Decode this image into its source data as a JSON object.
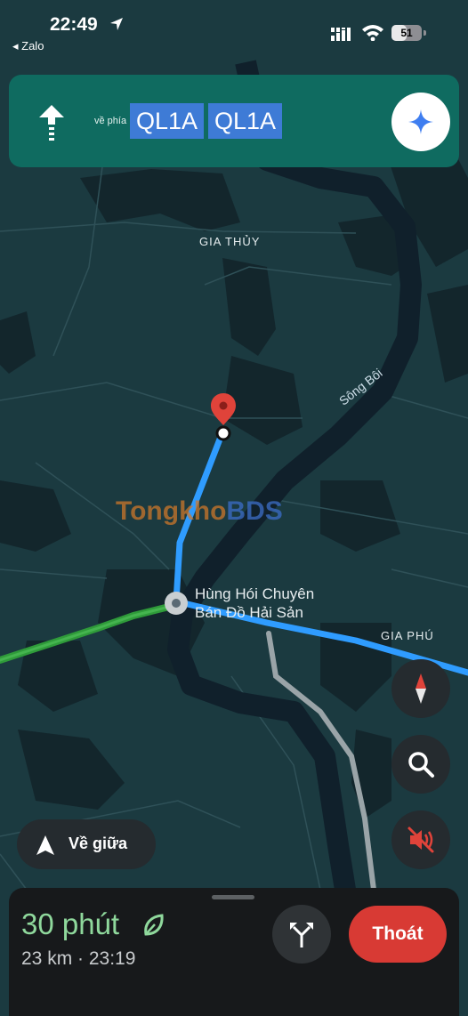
{
  "status_bar": {
    "time": "22:49",
    "back_app": "◂ Zalo",
    "battery_level": "51",
    "battery_percent": 51
  },
  "navigation": {
    "toward_label": "về phía",
    "road_names": [
      "QL1A",
      "QL1A"
    ]
  },
  "map": {
    "place_labels": {
      "gia_thuy": "GIA THỦY",
      "gia_phu": "GIA PHÚ"
    },
    "river_label": "Sông Bôi",
    "poi_line1": "Hùng Hói Chuyên",
    "poi_line2": "Bán Đồ Hải Sản"
  },
  "watermark": {
    "part1": "Tongkho",
    "part2": "BDS"
  },
  "controls": {
    "recenter_label": "Về giữa"
  },
  "trip": {
    "duration": "30 phút",
    "details": "23 km · 23:19",
    "exit_label": "Thoát"
  },
  "colors": {
    "banner": "#0f6b60",
    "route": "#2f9cff",
    "exit": "#d83a34",
    "eta": "#8fd89c"
  }
}
